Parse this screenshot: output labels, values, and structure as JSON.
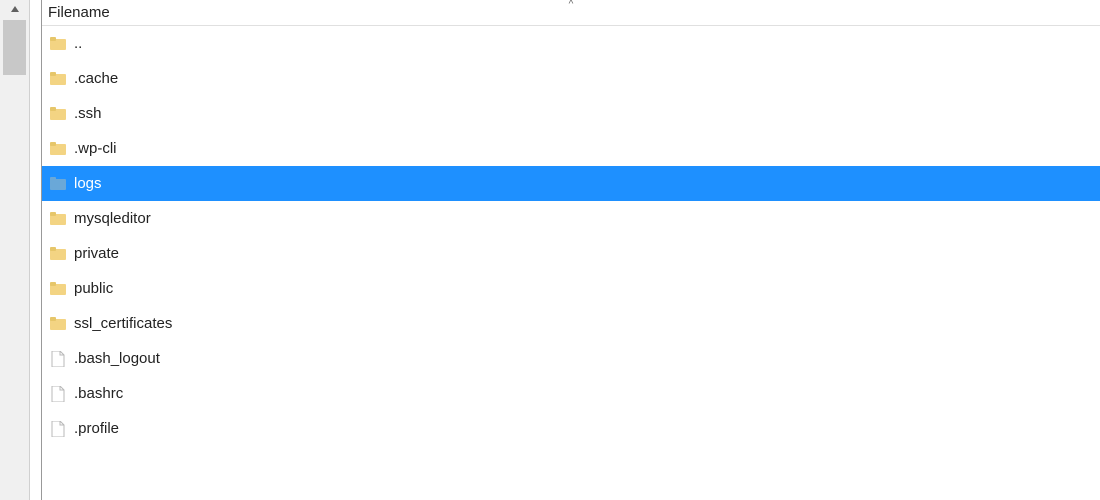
{
  "header": {
    "column_label": "Filename",
    "sort_glyph": "^"
  },
  "colors": {
    "selection_bg": "#1e90ff",
    "selection_fg": "#ffffff",
    "folder_fill": "#f3d483",
    "folder_tab": "#e6c66a",
    "folder_selected_fill": "#6aa8d8",
    "file_stroke": "#b8b8b8"
  },
  "items": [
    {
      "name": "..",
      "type": "folder",
      "selected": false
    },
    {
      "name": ".cache",
      "type": "folder",
      "selected": false
    },
    {
      "name": ".ssh",
      "type": "folder",
      "selected": false
    },
    {
      "name": ".wp-cli",
      "type": "folder",
      "selected": false
    },
    {
      "name": "logs",
      "type": "folder",
      "selected": true
    },
    {
      "name": "mysqleditor",
      "type": "folder",
      "selected": false
    },
    {
      "name": "private",
      "type": "folder",
      "selected": false
    },
    {
      "name": "public",
      "type": "folder",
      "selected": false
    },
    {
      "name": "ssl_certificates",
      "type": "folder",
      "selected": false
    },
    {
      "name": ".bash_logout",
      "type": "file",
      "selected": false
    },
    {
      "name": ".bashrc",
      "type": "file",
      "selected": false
    },
    {
      "name": ".profile",
      "type": "file",
      "selected": false
    }
  ]
}
